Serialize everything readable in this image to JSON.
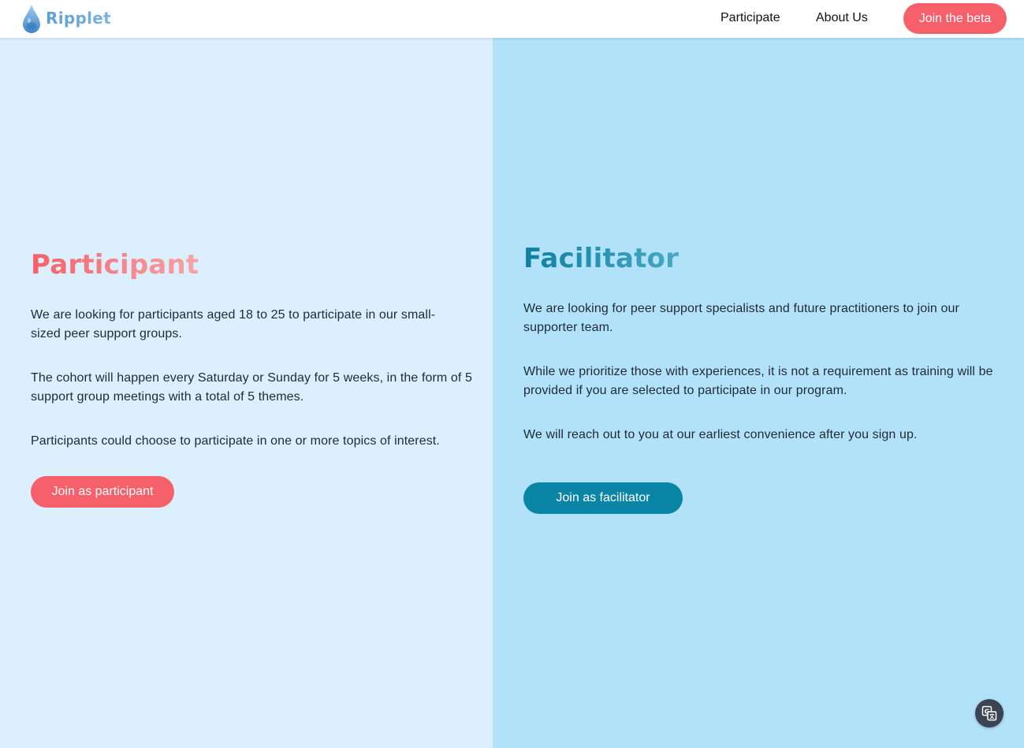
{
  "header": {
    "logo_text": "Ripplet",
    "nav": [
      {
        "label": "Participate"
      },
      {
        "label": "About Us"
      }
    ],
    "cta_label": "Join the beta"
  },
  "participant": {
    "heading": "Participant",
    "paragraphs": [
      "We are looking for participants aged 18 to 25 to participate in our small-sized peer support groups.",
      "The cohort will happen every Saturday or Sunday for 5 weeks, in the form of 5 support group meetings with a total of 5 themes.",
      "Participants could choose to participate in one or more topics of interest."
    ],
    "button_label": "Join as participant"
  },
  "facilitator": {
    "heading": "Facilitator",
    "paragraphs": [
      "We are looking for peer support specialists and future practitioners to join our supporter team.",
      "While we prioritize those with experiences, it is not a requirement as training will be provided if you are selected to participate in our program.",
      "We will reach out to you at our earliest convenience after you sign up."
    ],
    "button_label": "Join as facilitator"
  },
  "floating": {
    "translate_icon": "translate-icon"
  },
  "colors": {
    "accent_coral": "#f6606a",
    "accent_teal": "#0a85a6",
    "panel_left_bg": "#dbf0fc",
    "panel_right_bg": "#b2e2f9"
  }
}
